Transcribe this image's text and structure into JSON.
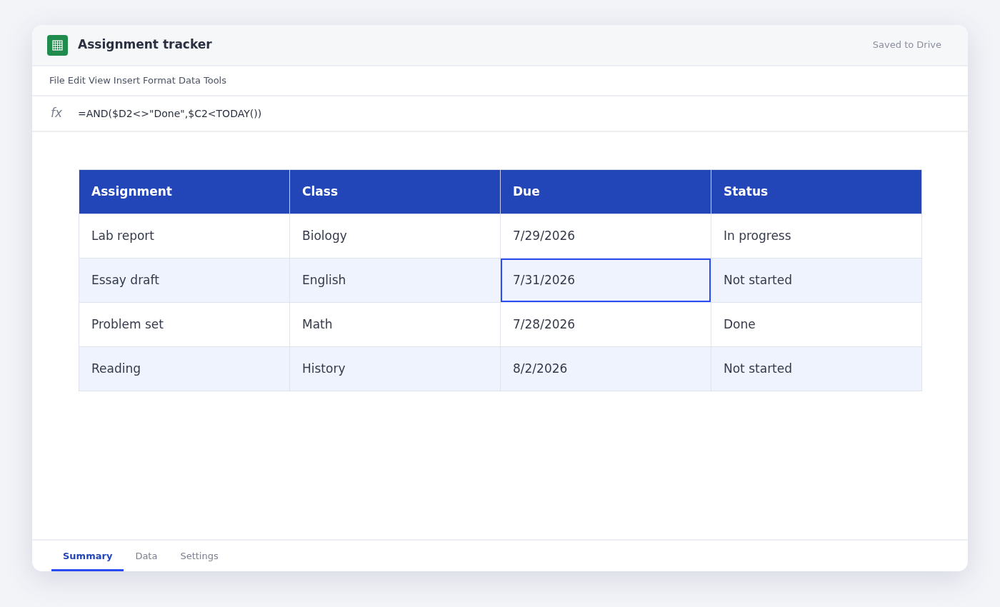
{
  "window": {
    "title": "Assignment tracker",
    "save_status": "Saved to Drive"
  },
  "menu": [
    "File",
    "Edit",
    "View",
    "Insert",
    "Format",
    "Data",
    "Tools"
  ],
  "formula_bar": {
    "label": "fx",
    "value": "=AND($D2<>\"Done\",$C2<TODAY())"
  },
  "table": {
    "columns": [
      "Assignment",
      "Class",
      "Due",
      "Status"
    ],
    "rows": [
      {
        "cells": [
          {
            "text": "Lab report",
            "selected": false
          },
          {
            "text": "Biology",
            "selected": false
          },
          {
            "text": "7/29/2026",
            "selected": false
          },
          {
            "text": "In progress",
            "selected": false
          }
        ]
      },
      {
        "cells": [
          {
            "text": "Essay draft",
            "selected": false
          },
          {
            "text": "English",
            "selected": false
          },
          {
            "text": "7/31/2026",
            "selected": true
          },
          {
            "text": "Not started",
            "selected": false
          }
        ]
      },
      {
        "cells": [
          {
            "text": "Problem set",
            "selected": false
          },
          {
            "text": "Math",
            "selected": false
          },
          {
            "text": "7/28/2026",
            "selected": false
          },
          {
            "text": "Done",
            "selected": false
          }
        ]
      },
      {
        "cells": [
          {
            "text": "Reading",
            "selected": false
          },
          {
            "text": "History",
            "selected": false
          },
          {
            "text": "8/2/2026",
            "selected": false
          },
          {
            "text": "Not started",
            "selected": false
          }
        ]
      }
    ]
  },
  "sheet_tabs": [
    {
      "label": "Summary",
      "selected": true
    },
    {
      "label": "Data",
      "selected": false
    },
    {
      "label": "Settings",
      "selected": false
    }
  ]
}
